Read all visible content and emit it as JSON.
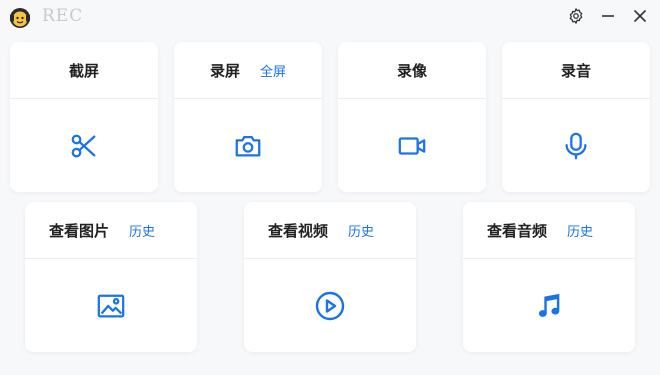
{
  "app": {
    "title": "REC"
  },
  "window_controls": {
    "settings_icon": "gear-icon",
    "minimize_icon": "minimize-icon",
    "close_icon": "close-icon"
  },
  "accent_color": "#1a73e8",
  "cards_row1": [
    {
      "title": "截屏",
      "link": "",
      "icon": "scissors-icon"
    },
    {
      "title": "录屏",
      "link": "全屏",
      "icon": "camera-icon"
    },
    {
      "title": "录像",
      "link": "",
      "icon": "video-camera-icon"
    },
    {
      "title": "录音",
      "link": "",
      "icon": "microphone-icon"
    }
  ],
  "cards_row2": [
    {
      "title": "查看图片",
      "link": "历史",
      "icon": "image-icon"
    },
    {
      "title": "查看视频",
      "link": "历史",
      "icon": "play-circle-icon"
    },
    {
      "title": "查看音频",
      "link": "历史",
      "icon": "music-note-icon"
    }
  ]
}
